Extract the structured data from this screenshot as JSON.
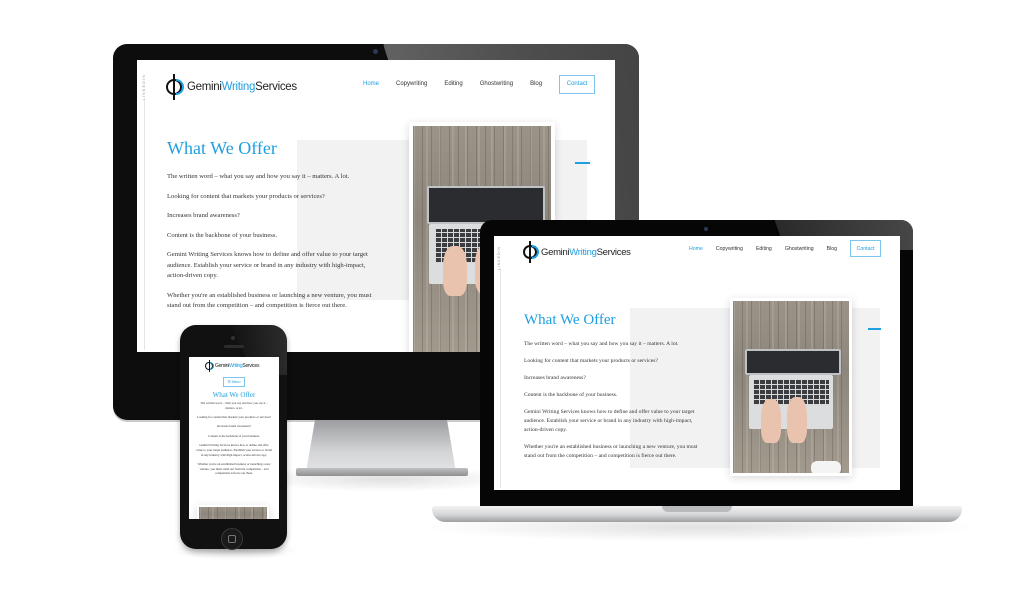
{
  "site": {
    "logo": {
      "part1": "Gemini",
      "part2": "Writing",
      "part3": "Services"
    },
    "side_label": "LINKEDIN",
    "nav": {
      "items": [
        {
          "label": "Home",
          "active": true
        },
        {
          "label": "Copywriting",
          "active": false
        },
        {
          "label": "Editing",
          "active": false
        },
        {
          "label": "Ghostwriting",
          "active": false
        },
        {
          "label": "Blog",
          "active": false
        }
      ],
      "contact_label": "Contact",
      "menu_label": "☰ Menu"
    },
    "heading": "What We Offer",
    "paragraphs": [
      "The written word – what you say and how you say it – matters. A lot.",
      "Looking for content that markets your products or services?",
      "Increases brand awareness?",
      "Content is the backbone of your business.",
      "Gemini Writing Services knows how to define and offer value to your target audience. Establish your service or brand in any industry with high-impact, action-driven copy.",
      "Whether you're an established business or launching a new venture, you must stand out from the competition – and competition is fierce out there."
    ],
    "image_alt": "hands-typing-on-laptop-photo"
  },
  "devices": [
    "desktop-monitor",
    "laptop",
    "smartphone"
  ],
  "colors": {
    "accent": "#1e9fe0",
    "text": "#333333",
    "panel": "#f2f2f3"
  }
}
